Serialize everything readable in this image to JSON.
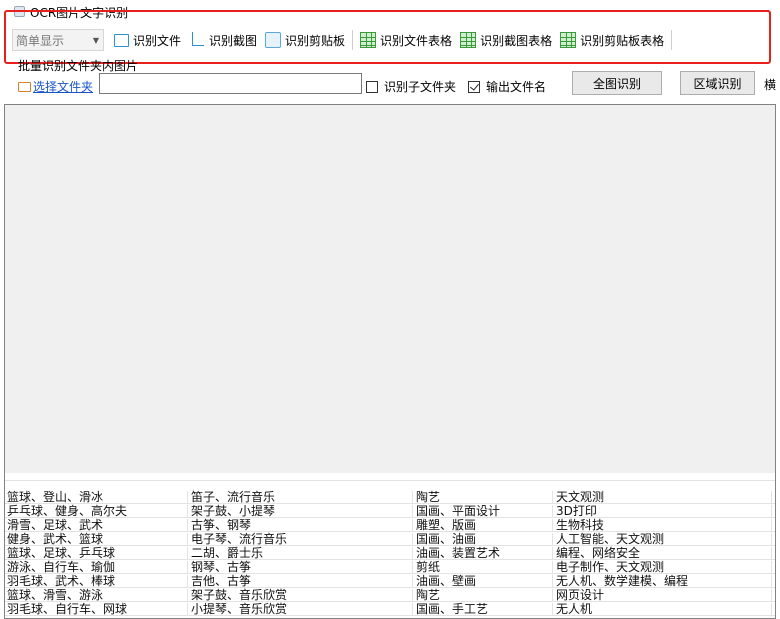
{
  "window": {
    "title": "OCR图片文字识别"
  },
  "toolbar": {
    "mode_value": "简单显示",
    "buttons": [
      {
        "label": "识别文件",
        "icon": "file-frame-icon"
      },
      {
        "label": "识别截图",
        "icon": "crop-icon"
      },
      {
        "label": "识别剪贴板",
        "icon": "clipboard-icon"
      },
      {
        "label": "识别文件表格",
        "icon": "table-icon"
      },
      {
        "label": "识别截图表格",
        "icon": "table-icon"
      },
      {
        "label": "识别剪贴板表格",
        "icon": "table-icon"
      }
    ]
  },
  "batch": {
    "section_label": "批量识别文件夹内图片",
    "select_folder_label": "选择文件夹",
    "path_value": "",
    "include_subfolders_label": "识别子文件夹",
    "include_subfolders_checked": false,
    "output_filename_label": "输出文件名",
    "output_filename_checked": true,
    "full_recognize_button": "全图识别",
    "region_recognize_button": "区域识别",
    "cut_off_label": "横"
  },
  "colors": {
    "highlight": "#e8201b",
    "link": "#1a55c8",
    "table_icon": "#3a9a3a",
    "file_icon": "#2d8fd6"
  },
  "table": {
    "rows": [
      [
        "篮球、登山、滑冰",
        "笛子、流行音乐",
        "陶艺",
        "天文观测"
      ],
      [
        "乒乓球、健身、高尔夫",
        "架子鼓、小提琴",
        "国画、平面设计",
        "3D打印"
      ],
      [
        "滑雪、足球、武术",
        "古筝、钢琴",
        "雕塑、版画",
        "生物科技"
      ],
      [
        "健身、武术、篮球",
        "电子琴、流行音乐",
        "国画、油画",
        "人工智能、天文观测"
      ],
      [
        "篮球、足球、乒乓球",
        "二胡、爵士乐",
        "油画、装置艺术",
        "编程、网络安全"
      ],
      [
        "游泳、自行车、瑜伽",
        "钢琴、古筝",
        "剪纸",
        "电子制作、天文观测"
      ],
      [
        "羽毛球、武术、棒球",
        "吉他、古筝",
        "油画、壁画",
        "无人机、数学建模、编程"
      ],
      [
        "篮球、滑雪、游泳",
        "架子鼓、音乐欣赏",
        "陶艺",
        "网页设计"
      ],
      [
        "羽毛球、自行车、网球",
        "小提琴、音乐欣赏",
        "国画、手工艺",
        "无人机"
      ]
    ]
  }
}
